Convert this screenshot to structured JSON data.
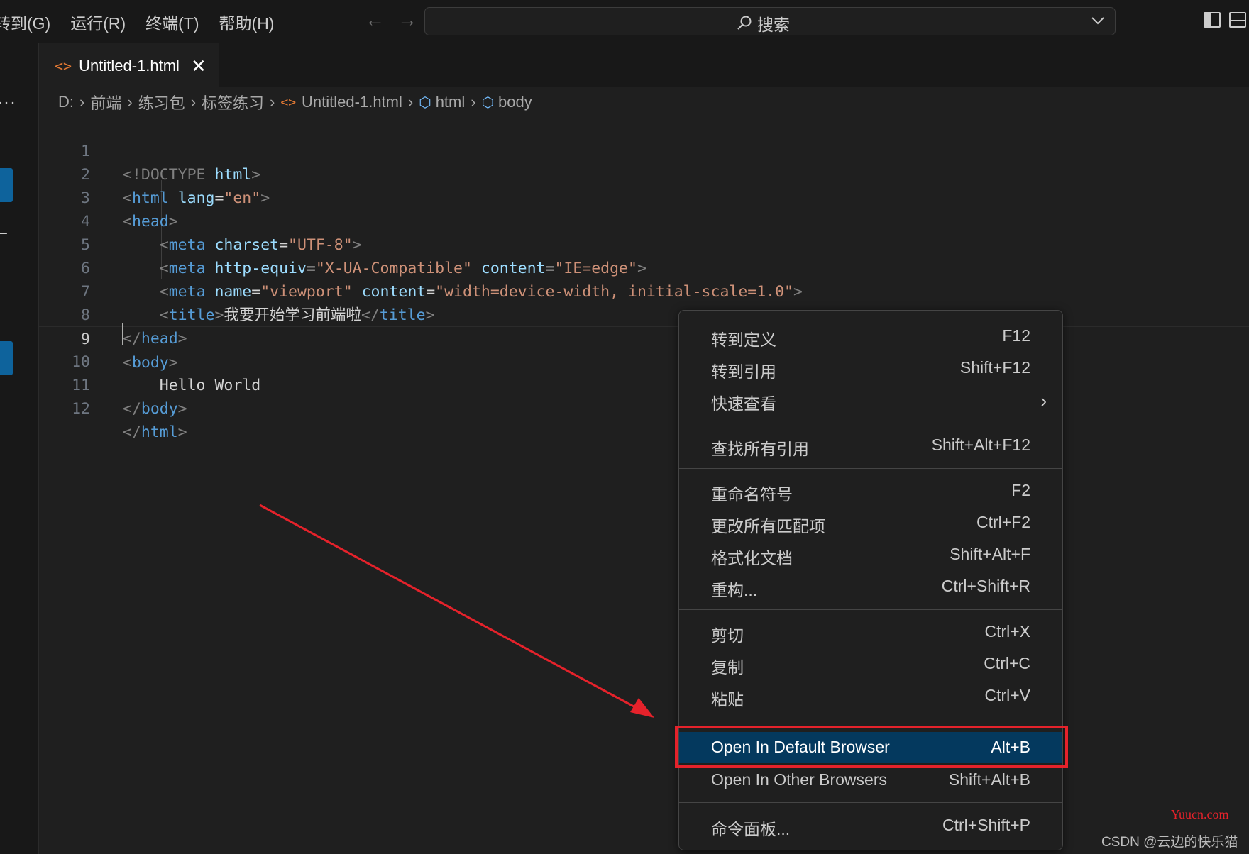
{
  "titlebar": {
    "menu": [
      "转到(G)",
      "运行(R)",
      "终端(T)",
      "帮助(H)"
    ],
    "back_icon": "arrow-left-icon",
    "forward_icon": "arrow-right-icon",
    "search_label": "搜索"
  },
  "tab": {
    "label": "Untitled-1.html",
    "close": "✕"
  },
  "breadcrumb": {
    "drive": "D:",
    "folders": [
      "前端",
      "练习包",
      "标签练习"
    ],
    "file": "Untitled-1.html",
    "symbols": [
      "html",
      "body"
    ]
  },
  "editor": {
    "active_line": "9",
    "lines": [
      {
        "n": "1"
      },
      {
        "n": "2"
      },
      {
        "n": "3"
      },
      {
        "n": "4"
      },
      {
        "n": "5"
      },
      {
        "n": "6"
      },
      {
        "n": "7"
      },
      {
        "n": "8"
      },
      {
        "n": "9"
      },
      {
        "n": "10"
      },
      {
        "n": "11"
      },
      {
        "n": "12"
      }
    ],
    "code": {
      "doctype": "!DOCTYPE",
      "html": "html",
      "lang_attr": "lang",
      "lang_val": "\"en\"",
      "head": "head",
      "meta": "meta",
      "charset_attr": "charset",
      "charset_val": "\"UTF-8\"",
      "http_equiv_attr": "http-equiv",
      "http_equiv_val": "\"X-UA-Compatible\"",
      "content_attr": "content",
      "content_val1": "\"IE=edge\"",
      "name_attr": "name",
      "name_val": "\"viewport\"",
      "content_val2": "\"width=device-width, initial-scale=1.0\"",
      "title": "title",
      "title_text": "我要开始学习前端啦",
      "body": "body",
      "body_text": "Hello World"
    }
  },
  "context_menu": {
    "items": [
      {
        "label": "转到定义",
        "key": "F12"
      },
      {
        "label": "转到引用",
        "key": "Shift+F12"
      },
      {
        "label": "快速查看",
        "key": ""
      },
      {
        "label": "查找所有引用",
        "key": "Shift+Alt+F12"
      },
      {
        "label": "重命名符号",
        "key": "F2"
      },
      {
        "label": "更改所有匹配项",
        "key": "Ctrl+F2"
      },
      {
        "label": "格式化文档",
        "key": "Shift+Alt+F"
      },
      {
        "label": "重构...",
        "key": "Ctrl+Shift+R"
      },
      {
        "label": "剪切",
        "key": "Ctrl+X"
      },
      {
        "label": "复制",
        "key": "Ctrl+C"
      },
      {
        "label": "粘贴",
        "key": "Ctrl+V"
      },
      {
        "label": "Open In Default Browser",
        "key": "Alt+B"
      },
      {
        "label": "Open In Other Browsers",
        "key": "Shift+Alt+B"
      },
      {
        "label": "命令面板...",
        "key": "Ctrl+Shift+P"
      }
    ],
    "highlighted": "Open In Default Browser"
  },
  "colors": {
    "annotation_red": "#e5222b",
    "highlight": "#04395e"
  },
  "watermark": {
    "site": "Yuucn.com",
    "author": "CSDN @云边的快乐猫"
  }
}
